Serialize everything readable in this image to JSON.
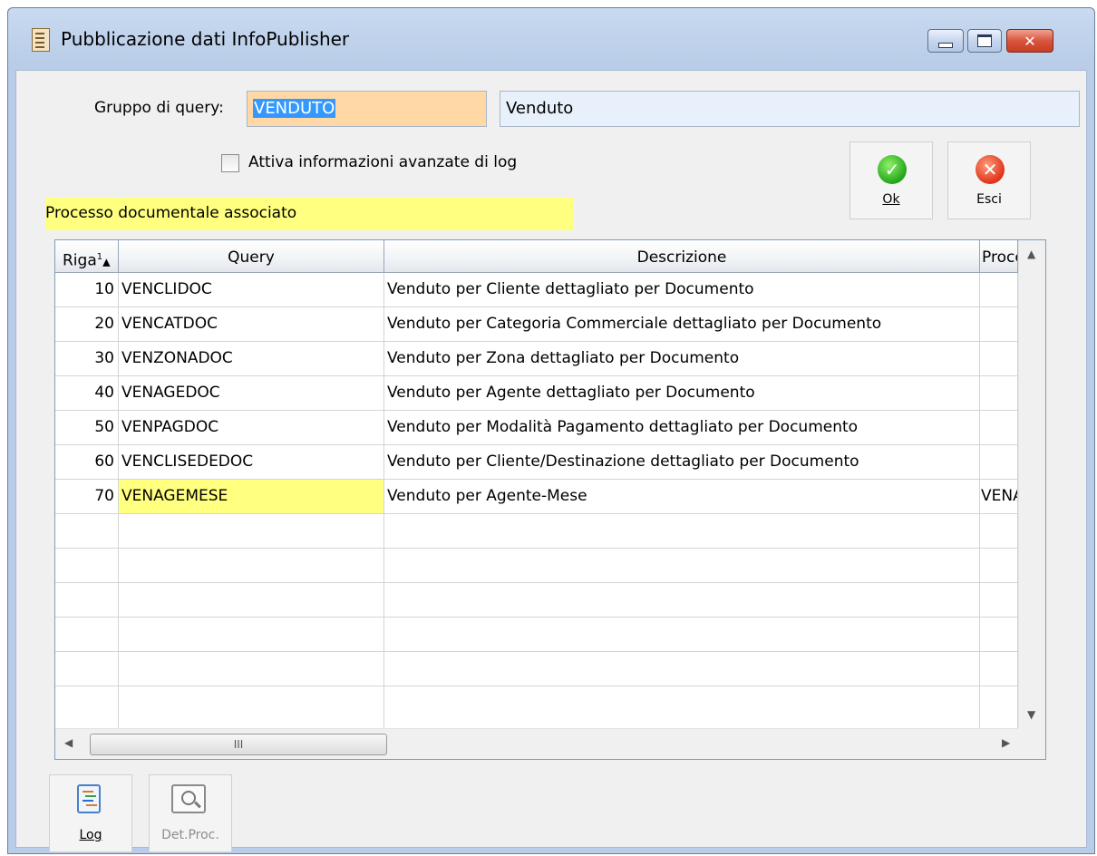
{
  "window": {
    "title": "Pubblicazione dati InfoPublisher",
    "minimize_label": "",
    "maximize_label": "",
    "close_label": "✕"
  },
  "form": {
    "group_label": "Gruppo di query:",
    "group_code": "VENDUTO",
    "group_desc": "Venduto",
    "log_checkbox_label": "Attiva informazioni avanzate di log",
    "log_checkbox_checked": false,
    "process_label": "Processo documentale associato"
  },
  "actions": {
    "ok_label": "Ok",
    "esci_label": "Esci"
  },
  "grid": {
    "columns": [
      "Riga",
      "Query",
      "Descrizione",
      "Proces"
    ],
    "sort_indicator": "1",
    "rows": [
      {
        "riga": "10",
        "query": "VENCLIDOC",
        "descrizione": "Venduto per Cliente dettagliato per Documento",
        "processo": ""
      },
      {
        "riga": "20",
        "query": "VENCATDOC",
        "descrizione": "Venduto per Categoria Commerciale dettagliato per Documento",
        "processo": ""
      },
      {
        "riga": "30",
        "query": "VENZONADOC",
        "descrizione": "Venduto per Zona dettagliato per Documento",
        "processo": ""
      },
      {
        "riga": "40",
        "query": "VENAGEDOC",
        "descrizione": "Venduto per Agente dettagliato per Documento",
        "processo": ""
      },
      {
        "riga": "50",
        "query": "VENPAGDOC",
        "descrizione": "Venduto per Modalità Pagamento dettagliato per Documento",
        "processo": ""
      },
      {
        "riga": "60",
        "query": "VENCLISEDEDOC",
        "descrizione": "Venduto per Cliente/Destinazione dettagliato per Documento",
        "processo": ""
      },
      {
        "riga": "70",
        "query": "VENAGEMESE",
        "descrizione": "Venduto per Agente-Mese",
        "processo": "VENA("
      }
    ],
    "hscroll_thumb_label": "III"
  },
  "bottom": {
    "log_label": "Log",
    "detproc_label": "Det.Proc."
  }
}
